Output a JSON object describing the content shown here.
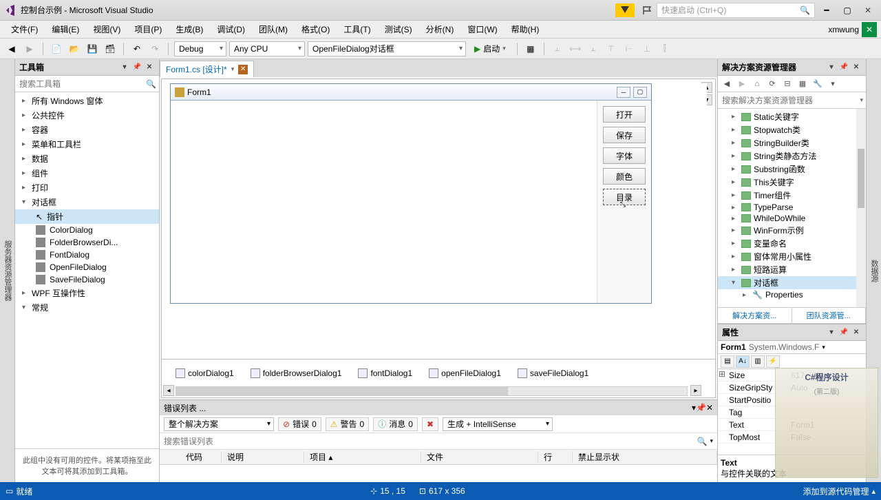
{
  "titlebar": {
    "title": "控制台示例 - Microsoft Visual Studio",
    "quicklaunch_placeholder": "快速启动 (Ctrl+Q)"
  },
  "menu": {
    "items": [
      "文件(F)",
      "编辑(E)",
      "视图(V)",
      "项目(P)",
      "生成(B)",
      "调试(D)",
      "团队(M)",
      "格式(O)",
      "工具(T)",
      "测试(S)",
      "分析(N)",
      "窗口(W)",
      "帮助(H)"
    ],
    "username": "xmwung"
  },
  "toolbar": {
    "config": "Debug",
    "platform": "Any CPU",
    "target": "OpenFileDialog对话框",
    "start": "启动"
  },
  "side_left_tab": "服务器资源管理器",
  "side_right_tab": "数据源",
  "toolbox": {
    "title": "工具箱",
    "search_placeholder": "搜索工具箱",
    "groups": [
      {
        "label": "所有 Windows 窗体",
        "expanded": false
      },
      {
        "label": "公共控件",
        "expanded": false
      },
      {
        "label": "容器",
        "expanded": false
      },
      {
        "label": "菜单和工具栏",
        "expanded": false
      },
      {
        "label": "数据",
        "expanded": false
      },
      {
        "label": "组件",
        "expanded": false
      },
      {
        "label": "打印",
        "expanded": false
      },
      {
        "label": "对话框",
        "expanded": true,
        "items": [
          {
            "label": "指针",
            "selected": true
          },
          {
            "label": "ColorDialog"
          },
          {
            "label": "FolderBrowserDi..."
          },
          {
            "label": "FontDialog"
          },
          {
            "label": "OpenFileDialog"
          },
          {
            "label": "SaveFileDialog"
          }
        ]
      },
      {
        "label": "WPF 互操作性",
        "expanded": false
      },
      {
        "label": "常规",
        "expanded": true
      }
    ],
    "desc": "此组中没有可用的控件。将某项拖至此文本可将其添加到工具箱。"
  },
  "doc_tab": {
    "label": "Form1.cs [设计]*"
  },
  "form": {
    "title": "Form1",
    "buttons": [
      "打开",
      "保存",
      "字体",
      "颜色",
      "目录"
    ]
  },
  "components": [
    "colorDialog1",
    "folderBrowserDialog1",
    "fontDialog1",
    "openFileDialog1",
    "saveFileDialog1"
  ],
  "errorlist": {
    "title": "错误列表 ...",
    "scope": "整个解决方案",
    "errors_lbl": "错误",
    "errors_n": "0",
    "warnings_lbl": "警告",
    "warnings_n": "0",
    "messages_lbl": "消息",
    "messages_n": "0",
    "build_lbl": "生成 + IntelliSense",
    "search_placeholder": "搜索错误列表",
    "cols": [
      "",
      "代码",
      "说明",
      "项目",
      "文件",
      "行",
      "禁止显示状"
    ]
  },
  "solution": {
    "title": "解决方案资源管理器",
    "search_placeholder": "搜索解决方案资源管理器",
    "items": [
      "Static关键字",
      "Stopwatch类",
      "StringBuilder类",
      "String类静态方法",
      "Substring函数",
      "This关键字",
      "Timer组件",
      "TypeParse",
      "WhileDoWhile",
      "WinForm示例",
      "变量命名",
      "窗体常用小属性",
      "短路运算",
      "对话框"
    ],
    "selected": "对话框",
    "properties_label": "Properties",
    "tabs": [
      "解决方案资...",
      "团队资源管..."
    ]
  },
  "props": {
    "title": "属性",
    "object_name": "Form1",
    "object_type": "System.Windows.F",
    "rows": [
      {
        "name": "Size",
        "value": "617, 356",
        "expand": true
      },
      {
        "name": "SizeGripSty",
        "value": "Auto"
      },
      {
        "name": "StartPositio",
        "value": ""
      },
      {
        "name": "Tag",
        "value": ""
      },
      {
        "name": "Text",
        "value": "Form1"
      },
      {
        "name": "TopMost",
        "value": "False"
      }
    ],
    "desc_name": "Text",
    "desc_text": "与控件关联的文本"
  },
  "overlay": {
    "title": "C#程序设计",
    "sub": "(第二版)"
  },
  "statusbar": {
    "ready": "就绪",
    "pos": "15 , 15",
    "size": "617 x 356",
    "right": "添加到源代码管理"
  }
}
